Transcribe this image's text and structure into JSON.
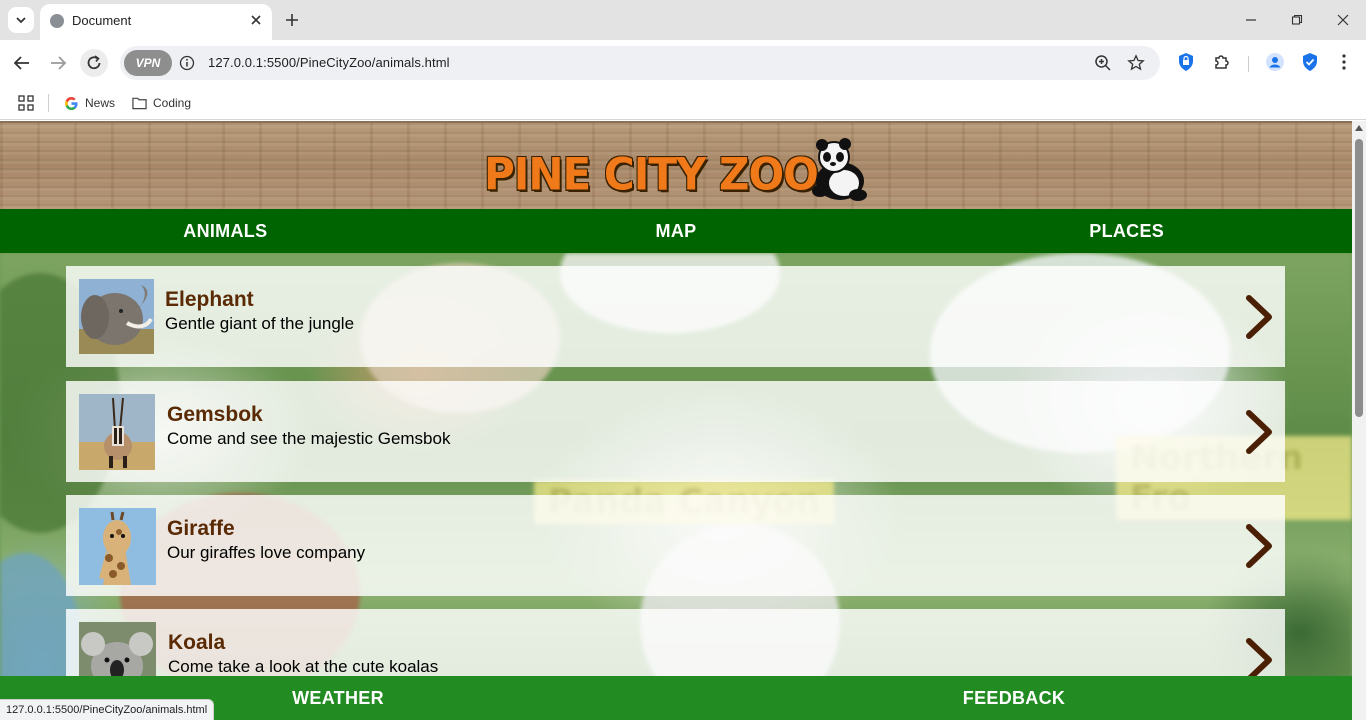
{
  "browser": {
    "tab_title": "Document",
    "url": "127.0.0.1:5500/PineCityZoo/animals.html",
    "vpn_label": "VPN",
    "bookmarks": [
      {
        "label": "News",
        "icon": "google-icon"
      },
      {
        "label": "Coding",
        "icon": "folder-icon"
      }
    ],
    "status_url": "127.0.0.1:5500/PineCityZoo/animals.html"
  },
  "site": {
    "logo_text": "PINE CITY ZOO",
    "top_nav": [
      "ANIMALS",
      "MAP",
      "PLACES"
    ],
    "bottom_nav": [
      "WEATHER",
      "FEEDBACK"
    ],
    "background_signs": [
      "Panda Canyon",
      "Northern Fro"
    ]
  },
  "animals": [
    {
      "name": "Elephant",
      "description": "Gentle giant of the jungle"
    },
    {
      "name": "Gemsbok",
      "description": "Come and see the majestic Gemsbok"
    },
    {
      "name": "Giraffe",
      "description": "Our giraffes love company"
    },
    {
      "name": "Koala",
      "description": "Come take a look at the cute koalas"
    }
  ],
  "colors": {
    "header_nav": "#006400",
    "footer_nav": "#228b22",
    "title_brown": "#5a2a05",
    "logo_orange": "#f07a1a"
  }
}
